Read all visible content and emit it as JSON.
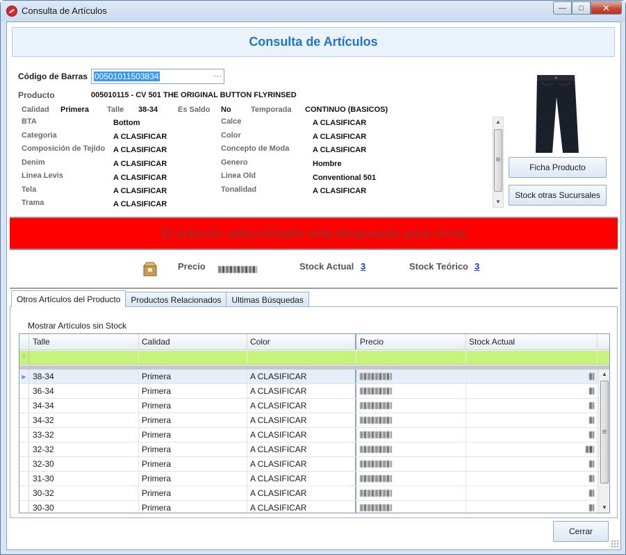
{
  "window": {
    "title": "Consulta de Artículos",
    "minimize": "—",
    "maximize": "□",
    "close": "✕"
  },
  "header": {
    "title": "Consulta de Artículos"
  },
  "barcode": {
    "label": "Código de Barras",
    "value": "00501011503834",
    "ellipsis": "···"
  },
  "product": {
    "label": "Producto",
    "value": "005010115 - CV 501 THE ORIGINAL BUTTON FLYRINSED",
    "calidad_label": "Calidad",
    "calidad": "Primera",
    "talle_label": "Talle",
    "talle": "38-34",
    "saldo_label": "Es Saldo",
    "saldo": "No",
    "temporada_label": "Temporada",
    "temporada": "CONTINUO (BASICOS)"
  },
  "attributes_left": [
    {
      "label": "BTA",
      "value": "Bottom"
    },
    {
      "label": "Categoria",
      "value": "A CLASIFICAR"
    },
    {
      "label": "Composición de Tejido",
      "value": "A CLASIFICAR"
    },
    {
      "label": "Denim",
      "value": "A CLASIFICAR"
    },
    {
      "label": "Linea Levis",
      "value": "A CLASIFICAR"
    },
    {
      "label": "Tela",
      "value": "A CLASIFICAR"
    },
    {
      "label": "Trama",
      "value": "A CLASIFICAR"
    }
  ],
  "attributes_right": [
    {
      "label": "Calce",
      "value": "A CLASIFICAR"
    },
    {
      "label": "Color",
      "value": "A CLASIFICAR"
    },
    {
      "label": "Concepto de Moda",
      "value": "A CLASIFICAR"
    },
    {
      "label": "Genero",
      "value": "Hombre"
    },
    {
      "label": "Linea Old",
      "value": "Conventional 501"
    },
    {
      "label": "Tonalidad",
      "value": "A CLASIFICAR"
    }
  ],
  "buttons": {
    "ficha": "Ficha Producto",
    "stock_sucursales": "Stock otras Sucursales",
    "cerrar": "Cerrar"
  },
  "alert": {
    "text": "El artículo seleccionado está bloqueado para venta"
  },
  "summary": {
    "precio_label": "Precio",
    "stock_actual_label": "Stock Actual",
    "stock_actual": "3",
    "stock_teorico_label": "Stock Teórico",
    "stock_teorico": "3"
  },
  "tabs": [
    "Otros Artículos del Producto",
    "Productos Relacionados",
    "Ultimas Búsquedas"
  ],
  "grid": {
    "show_no_stock_label": "Mostrar Artículos sin Stock",
    "columns": [
      "Talle",
      "Calidad",
      "Color",
      "Precio",
      "Stock Actual"
    ],
    "rows": [
      {
        "talle": "38-34",
        "calidad": "Primera",
        "color": "A CLASIFICAR",
        "stock": "3"
      },
      {
        "talle": "36-34",
        "calidad": "Primera",
        "color": "A CLASIFICAR",
        "stock": "5"
      },
      {
        "talle": "34-34",
        "calidad": "Primera",
        "color": "A CLASIFICAR",
        "stock": "5"
      },
      {
        "talle": "34-32",
        "calidad": "Primera",
        "color": "A CLASIFICAR",
        "stock": "5"
      },
      {
        "talle": "33-32",
        "calidad": "Primera",
        "color": "A CLASIFICAR",
        "stock": "2"
      },
      {
        "talle": "32-32",
        "calidad": "Primera",
        "color": "A CLASIFICAR",
        "stock": "15"
      },
      {
        "talle": "32-30",
        "calidad": "Primera",
        "color": "A CLASIFICAR",
        "stock": "5"
      },
      {
        "talle": "31-30",
        "calidad": "Primera",
        "color": "A CLASIFICAR",
        "stock": "5"
      },
      {
        "talle": "30-32",
        "calidad": "Primera",
        "color": "A CLASIFICAR",
        "stock": "4"
      },
      {
        "talle": "30-30",
        "calidad": "Primera",
        "color": "A CLASIFICAR",
        "stock": "4"
      }
    ]
  },
  "colors": {
    "accent": "#1f74c9",
    "alert_bg": "#ff0000",
    "filter_row": "#c6f47a",
    "link": "#1a3cd6"
  }
}
